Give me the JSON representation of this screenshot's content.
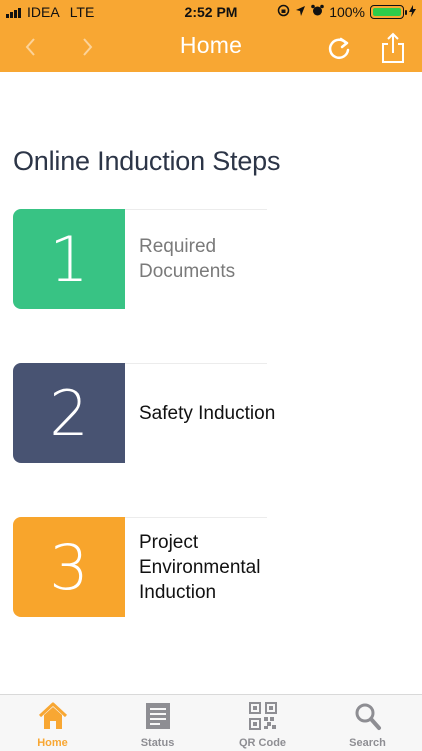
{
  "status_bar": {
    "carrier": "IDEA",
    "network": "LTE",
    "time": "2:52 PM",
    "battery_percent": "100%"
  },
  "nav": {
    "title": "Home",
    "back_icon": "chevron-left-icon",
    "forward_icon": "chevron-right-icon",
    "refresh_icon": "refresh-icon",
    "share_icon": "share-icon"
  },
  "main": {
    "heading": "Online Induction Steps",
    "steps": [
      {
        "number": "1",
        "label": "Required Documents",
        "color": "#38c384"
      },
      {
        "number": "2",
        "label": "Safety Induction",
        "color": "#485372"
      },
      {
        "number": "3",
        "label": "Project Environmental Induction",
        "color": "#f8a52c"
      }
    ]
  },
  "tabbar": {
    "tabs": [
      {
        "label": "Home",
        "icon": "home-icon",
        "active": true
      },
      {
        "label": "Status",
        "icon": "document-icon",
        "active": false
      },
      {
        "label": "QR Code",
        "icon": "qr-code-icon",
        "active": false
      },
      {
        "label": "Search",
        "icon": "search-icon",
        "active": false
      }
    ]
  },
  "colors": {
    "accent": "#f8a733",
    "tab_inactive": "#8e8e93",
    "battery": "#2ecc4a"
  }
}
